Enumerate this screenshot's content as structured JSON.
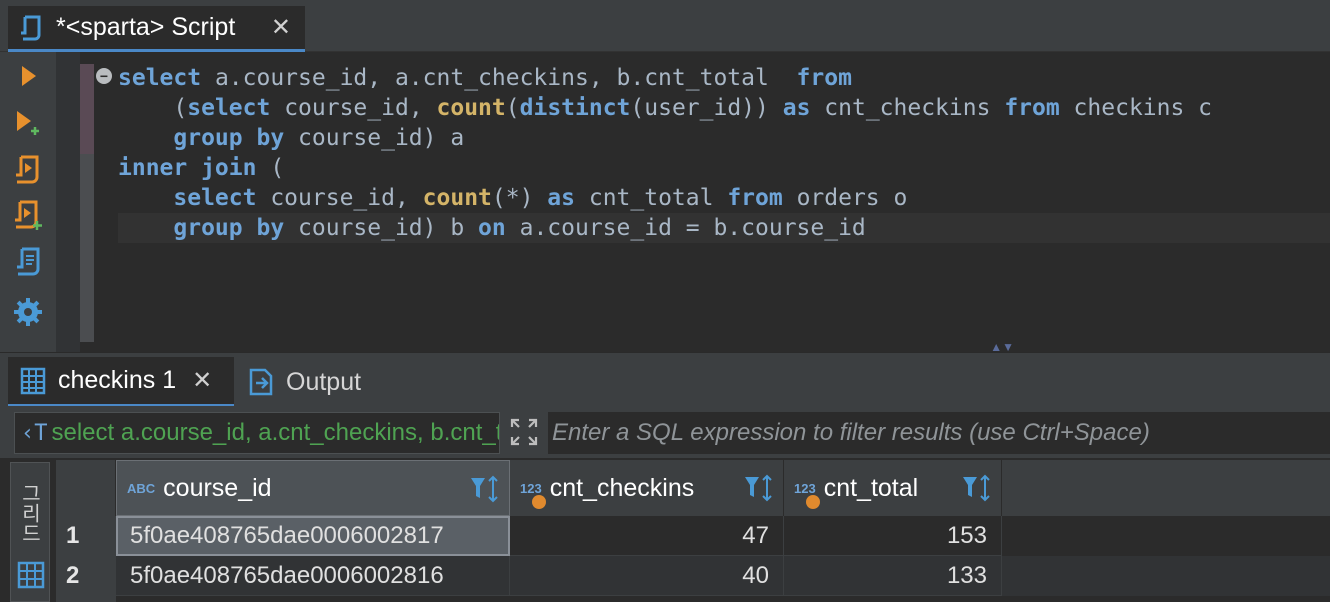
{
  "editor_tab": {
    "title": "*<sparta> Script",
    "close": "✕"
  },
  "toolbar": {
    "buttons": [
      "execute-icon",
      "execute-new-tab-icon",
      "execute-script-icon",
      "execute-script-new-tab-icon",
      "explain-plan-icon",
      "settings-icon"
    ]
  },
  "code_lines": [
    "select a.course_id, a.cnt_checkins, b.cnt_total  from",
    "    (select course_id, count(distinct(user_id)) as cnt_checkins from checkins c",
    "    group by course_id) a",
    "inner join (",
    "    select course_id, count(*) as cnt_total from orders o",
    "    group by course_id) b on a.course_id = b.course_id"
  ],
  "results_tabs": [
    {
      "label": "checkins 1",
      "close": "✕"
    },
    {
      "label": "Output"
    }
  ],
  "filter": {
    "query_prefix": "‹T",
    "query_text": "select a.course_id, a.cnt_checkins, b.cnt_total  from",
    "placeholder": "Enter a SQL expression to filter results (use Ctrl+Space)"
  },
  "side_panel_label": "그리드",
  "grid": {
    "columns": [
      {
        "type": "ABC",
        "name": "course_id"
      },
      {
        "type": "123",
        "name": "cnt_checkins"
      },
      {
        "type": "123",
        "name": "cnt_total"
      }
    ],
    "rows": [
      {
        "num": "1",
        "course_id": "5f0ae408765dae0006002817",
        "cnt_checkins": "47",
        "cnt_total": "153"
      },
      {
        "num": "2",
        "course_id": "5f0ae408765dae0006002816",
        "cnt_checkins": "40",
        "cnt_total": "133"
      }
    ]
  },
  "colors": {
    "keyword": "#6fa4d8",
    "function": "#d4b468",
    "accent": "#4a88c7",
    "query_text": "#4fa352",
    "numeric_dot": "#e08a2e"
  }
}
